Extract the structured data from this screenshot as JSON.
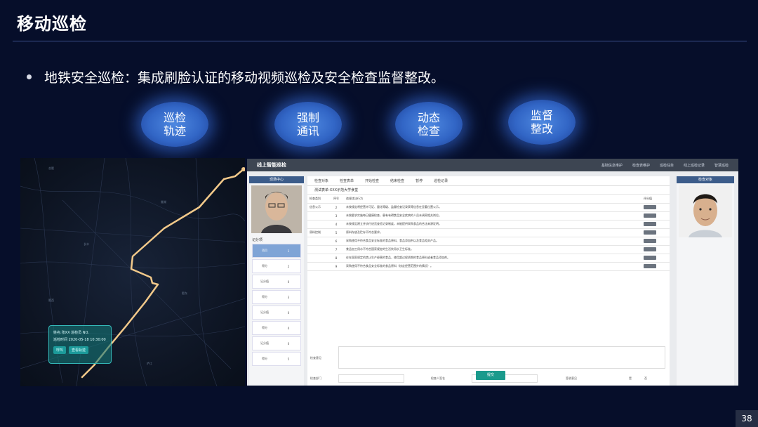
{
  "slide": {
    "title": "移动巡检",
    "bullet": "地铁安全巡检：集成刷脸认证的移动视频巡检及安全检查监督整改。",
    "page_number": "38"
  },
  "features": [
    {
      "label": "巡检\n轨迹"
    },
    {
      "label": "强制\n通讯"
    },
    {
      "label": "动态\n检查"
    },
    {
      "label": "监督\n整改"
    }
  ],
  "map": {
    "popup_line1": "姓名:张XX 巡检员 NO.",
    "popup_line2": "巡检时间 2020-05-18 10:30:00",
    "btn_call": "呼叫",
    "btn_track": "查看轨迹",
    "places": [
      "合肥",
      "巢湖",
      "长丰",
      "肥东",
      "肥西",
      "庐江"
    ],
    "track_color": "#f2c98a"
  },
  "app": {
    "brand": "线上智能巡检",
    "nav": [
      "基础信息维护",
      "检查表维护",
      "巡检任务",
      "线上巡检记录",
      "智慧巡检"
    ],
    "left_head": "现场中心",
    "records_title": "记分项",
    "records": [
      {
        "a": "项目",
        "b": "1"
      },
      {
        "a": "得分",
        "b": "2"
      },
      {
        "a": "记分值",
        "b": "0"
      },
      {
        "a": "得分",
        "b": "3"
      },
      {
        "a": "记分值",
        "b": "0"
      },
      {
        "a": "得分",
        "b": "4"
      },
      {
        "a": "记分值",
        "b": "0"
      },
      {
        "a": "得分",
        "b": "5"
      }
    ],
    "toolbar": [
      "检查对象",
      "检查表单",
      "开始检查",
      "结束检查",
      "暂停",
      "巡检记录"
    ],
    "form_title": "测试表单-XXX示范大学食堂",
    "col_heads": [
      "检查类别",
      "序号",
      "违规违法行为",
      "评分值"
    ],
    "rows": [
      {
        "cat": "信息公示",
        "num": "2",
        "text": "未按规定将经营许可证、量化等级、监督检查记录表等信息在显著位置公示。"
      },
      {
        "cat": "",
        "num": "3",
        "text": "未按要求实施每日健康检查，患有有碍食品安全疾病的人员未调离相关岗位。"
      },
      {
        "cat": "",
        "num": "4",
        "text": "未按规定建立并执行进货查验记录制度，未能提供采购食品的合法来源证明。"
      },
      {
        "cat": "原料控制",
        "num": "5",
        "text": "原料存放及贮存不符合要求。"
      },
      {
        "cat": "",
        "num": "6",
        "text": "采购使用不符合食品安全标准的食品原料、食品添加剂以及食品相关产品。"
      },
      {
        "cat": "",
        "num": "7",
        "text": "食品加工用水不符合国家规定的生活饮用水卫生标准。"
      },
      {
        "cat": "",
        "num": "8",
        "text": "存在国家规定的禁止生产经营的食品，使用超过保质期的食品原料或者食品添加剂。"
      },
      {
        "cat": "",
        "num": "9",
        "text": "采购使用不符合食品安全标准的食品原料（核定经营范围外的情况）。"
      }
    ],
    "remark_label": "检查意见",
    "bottom": {
      "dept": "检查部门",
      "inspector": "检查人签名",
      "person": "签收意见",
      "yes": "是",
      "no": "否"
    },
    "submit": "提交",
    "right_head": "检查对象"
  }
}
